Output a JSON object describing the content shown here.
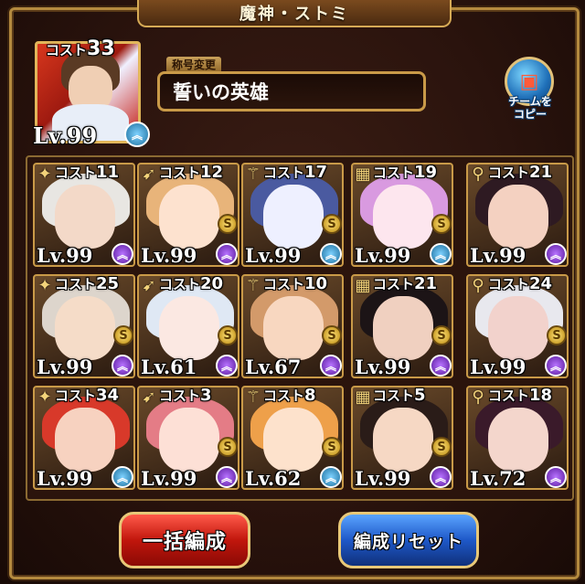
{
  "window_title": "魔神・ストミ",
  "leader": {
    "cost_label": "コスト",
    "cost": "33",
    "level": "Lv.99",
    "rank_icon": "awakening-chevron-icon"
  },
  "title_tag": "称号変更",
  "title_value": "誓いの英雄",
  "copy_button": {
    "label_line1": "チームを",
    "label_line2": "コピー"
  },
  "members": [
    {
      "cost_label": "コスト",
      "cost": "11",
      "level": "Lv.99",
      "rank": "purple",
      "s": false,
      "c1": "#e8e6e2",
      "c2": "#f3d9c8"
    },
    {
      "cost_label": "コスト",
      "cost": "12",
      "level": "Lv.99",
      "rank": "purple",
      "s": true,
      "c1": "#e8b47a",
      "c2": "#fde2cf"
    },
    {
      "cost_label": "コスト",
      "cost": "17",
      "level": "Lv.99",
      "rank": "blue",
      "s": true,
      "c1": "#4a5aa0",
      "c2": "#eef0ff"
    },
    {
      "cost_label": "コスト",
      "cost": "19",
      "level": "Lv.99",
      "rank": "blue",
      "s": true,
      "c1": "#d99ae0",
      "c2": "#fde6ee"
    },
    {
      "cost_label": "コスト",
      "cost": "21",
      "level": "Lv.99",
      "rank": "purple",
      "s": false,
      "c1": "#2e1a22",
      "c2": "#f4d1c1"
    },
    {
      "cost_label": "コスト",
      "cost": "25",
      "level": "Lv.99",
      "rank": "purple",
      "s": true,
      "c1": "#ddd5cc",
      "c2": "#f5dcc8"
    },
    {
      "cost_label": "コスト",
      "cost": "20",
      "level": "Lv.61",
      "rank": "purple",
      "s": true,
      "c1": "#dfe8f4",
      "c2": "#fbe8e2"
    },
    {
      "cost_label": "コスト",
      "cost": "10",
      "level": "Lv.67",
      "rank": "purple",
      "s": true,
      "c1": "#d39a6a",
      "c2": "#f8d7c0"
    },
    {
      "cost_label": "コスト",
      "cost": "21",
      "level": "Lv.99",
      "rank": "purple",
      "s": true,
      "c1": "#1c1416",
      "c2": "#f0d0c0"
    },
    {
      "cost_label": "コスト",
      "cost": "24",
      "level": "Lv.99",
      "rank": "purple",
      "s": true,
      "c1": "#e8e8ee",
      "c2": "#f2d2cc"
    },
    {
      "cost_label": "コスト",
      "cost": "34",
      "level": "Lv.99",
      "rank": "blue",
      "s": false,
      "c1": "#d8392a",
      "c2": "#f7d2c0"
    },
    {
      "cost_label": "コスト",
      "cost": "3",
      "level": "Lv.99",
      "rank": "purple",
      "s": true,
      "c1": "#e47c86",
      "c2": "#fde0d6"
    },
    {
      "cost_label": "コスト",
      "cost": "8",
      "level": "Lv.62",
      "rank": "blue",
      "s": true,
      "c1": "#eea04a",
      "c2": "#fde2cc"
    },
    {
      "cost_label": "コスト",
      "cost": "5",
      "level": "Lv.99",
      "rank": "purple",
      "s": true,
      "c1": "#2a1c18",
      "c2": "#f6d8c4"
    },
    {
      "cost_label": "コスト",
      "cost": "18",
      "level": "Lv.72",
      "rank": "purple",
      "s": false,
      "c1": "#3a1a2a",
      "c2": "#f4d6cc"
    }
  ],
  "buttons": {
    "bulk_formation": "一括編成",
    "reset_formation": "編成リセット"
  },
  "badge_s": "S",
  "rank_glyph": "︽"
}
